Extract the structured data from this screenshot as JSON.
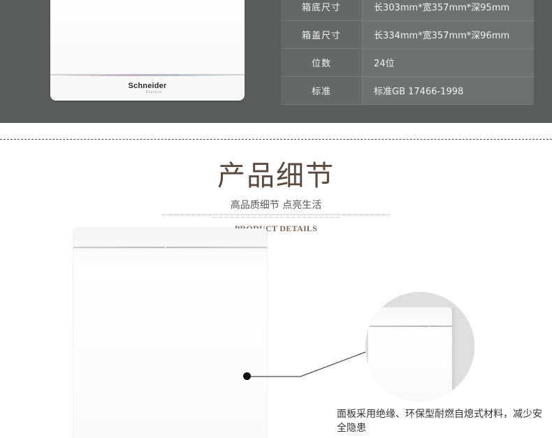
{
  "product_image": {
    "brand": "Schneider",
    "brand_sub": "Electric"
  },
  "specs": [
    {
      "label": "箱底尺寸",
      "value": "长303mm*宽357mm*深95mm"
    },
    {
      "label": "箱盖尺寸",
      "value": "长334mm*宽357mm*深96mm"
    },
    {
      "label": "位数",
      "value": "24位"
    },
    {
      "label": "标准",
      "value": "标准GB 17466-1998"
    }
  ],
  "details_section": {
    "title": "产品细节",
    "subtitle": "高品质细节 点亮生活",
    "title_en": "PRODUCT DETAILS",
    "description": "面板采用绝缘、环保型耐燃自熄式材料，减少安全隐患"
  },
  "colors": {
    "band": "#585c5d",
    "title": "#5a4a3f",
    "text": "#333333"
  }
}
